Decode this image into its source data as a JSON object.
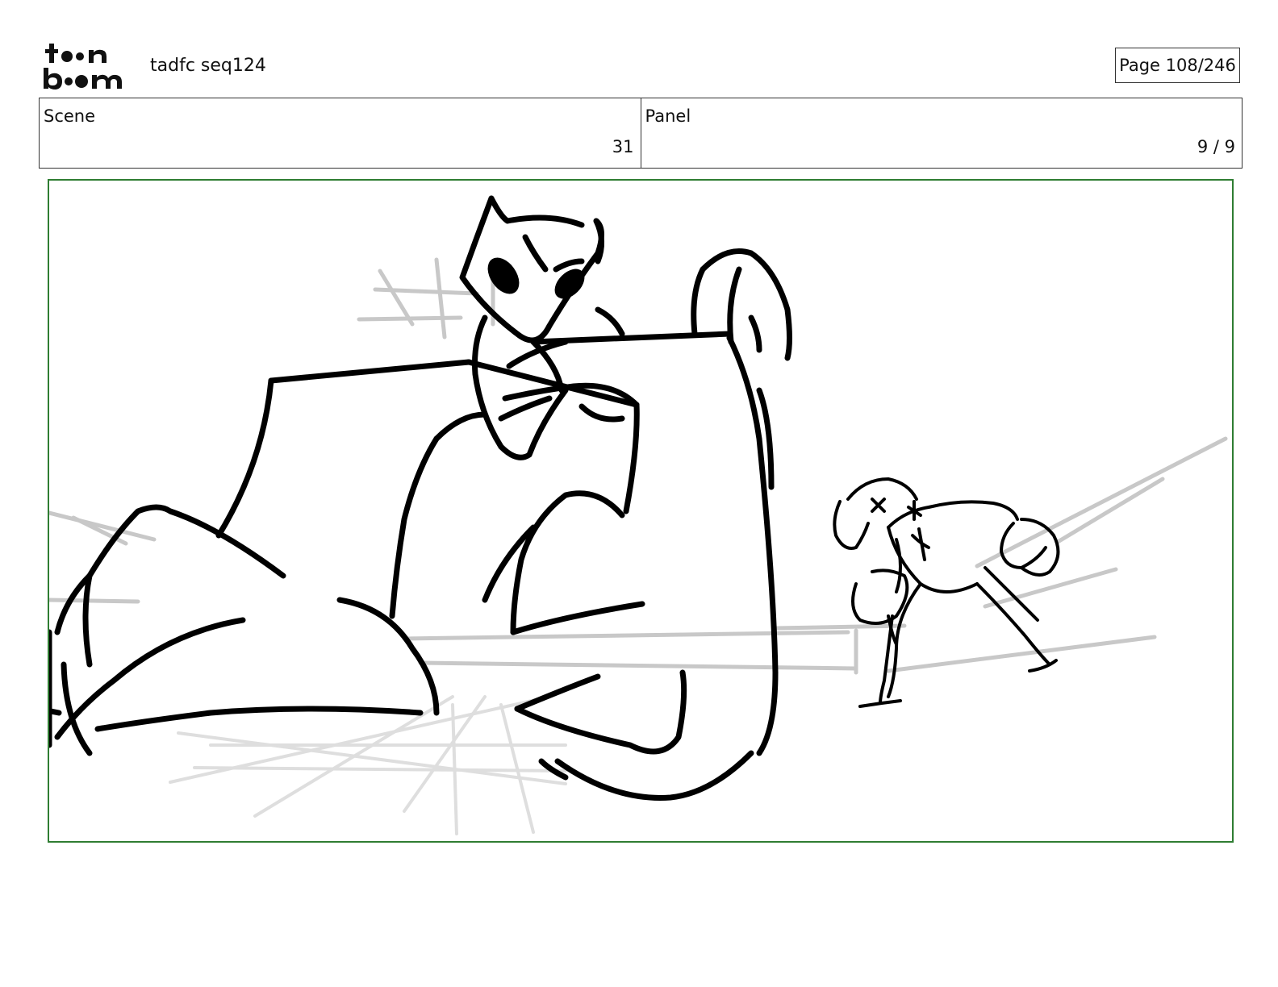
{
  "header": {
    "logo_text": "toon boom",
    "project_title": "tadfc seq124",
    "page_label": "Page 108/246"
  },
  "info": {
    "scene_label": "Scene",
    "scene_value": "31",
    "panel_label": "Panel",
    "panel_value": "9 / 9"
  },
  "colors": {
    "frame_border": "#2f7d32",
    "sketch_line": "#000000",
    "guide_line": "#c8c8c8"
  }
}
